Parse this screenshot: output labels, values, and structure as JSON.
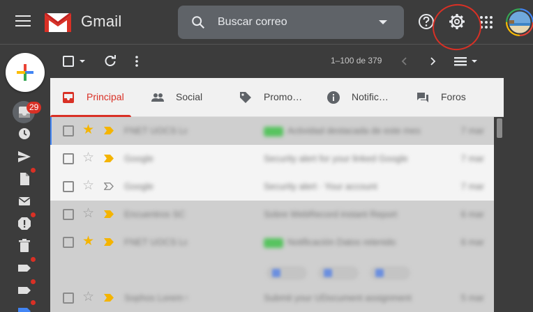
{
  "header": {
    "brand": "Gmail",
    "search_placeholder": "Buscar correo"
  },
  "sidebar": {
    "inbox_badge": "29"
  },
  "toolbar": {
    "pager_text": "1–100 de 379"
  },
  "tabs": [
    {
      "label": "Principal",
      "icon": "inbox-icon",
      "active": true
    },
    {
      "label": "Social",
      "icon": "people-icon",
      "active": false
    },
    {
      "label": "Promo…",
      "icon": "tag-icon",
      "active": false
    },
    {
      "label": "Notific…",
      "icon": "info-icon",
      "active": false
    },
    {
      "label": "Foros",
      "icon": "forum-icon",
      "active": false
    }
  ],
  "emails": [
    {
      "sender": "FNET UOCS Ledgers",
      "subject": "Actividad destacada de este mes",
      "date": "7 mar",
      "starred": true,
      "important": true,
      "chip": true
    },
    {
      "sender": "Google",
      "subject": "Security alert for your linked Google",
      "date": "7 mar",
      "starred": false,
      "important": true,
      "chip": false
    },
    {
      "sender": "Google",
      "subject": "Security alert · Your account",
      "date": "7 mar",
      "starred": false,
      "important": false,
      "chip": false
    },
    {
      "sender": "Encuentros SC Fisica",
      "subject": "Sobre WebRecord instant Report",
      "date": "6 mar",
      "starred": false,
      "important": true,
      "chip": false
    },
    {
      "sender": "FNET UOCS Ledgers",
      "subject": "Notificación Datos retenido",
      "date": "6 mar",
      "starred": true,
      "important": true,
      "chip": true
    },
    {
      "sender": "Sophos Lorem Grees",
      "subject": "Submit your UDocument assignment",
      "date": "5 mar",
      "starred": false,
      "important": true,
      "chip": false
    }
  ],
  "colors": {
    "accent": "#d93025",
    "star": "#f4b400",
    "important": "#f4b400",
    "header_bg": "#3c3c3c"
  }
}
